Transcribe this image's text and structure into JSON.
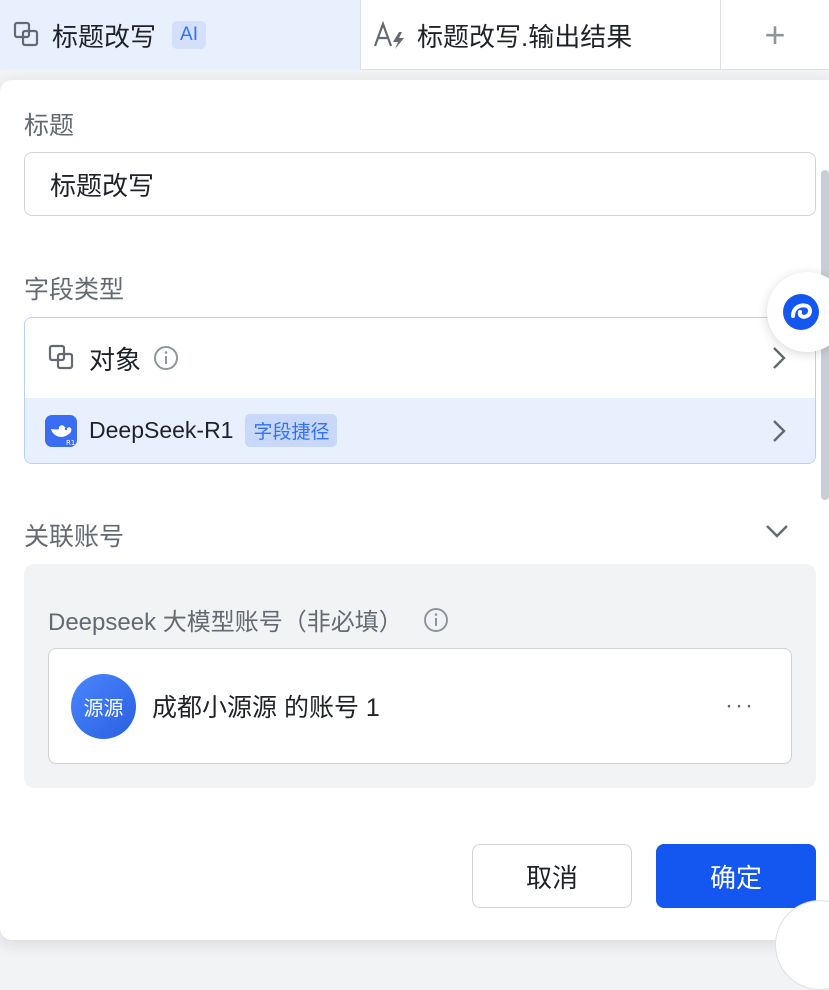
{
  "header": {
    "col1_title": "标题改写",
    "col1_badge": "AI",
    "col2_title": "标题改写.输出结果",
    "add_symbol": "+"
  },
  "form": {
    "title_label": "标题",
    "title_value": "标题改写",
    "field_type_label": "字段类型",
    "field_type_value": "对象",
    "shortcut_name": "DeepSeek-R1",
    "shortcut_tag": "字段捷径",
    "linked_account_label": "关联账号",
    "account_sub_label": "Deepseek 大模型账号（非必填）",
    "account_avatar_text": "源源",
    "account_name": "成都小源源 的账号 1",
    "more_symbol": "···"
  },
  "actions": {
    "cancel_label": "取消",
    "confirm_label": "确定"
  },
  "colors": {
    "primary": "#1456f0",
    "accent": "#3370ff",
    "selected_bg": "#e8effd"
  },
  "icons": [
    "object-field-icon",
    "formula-icon",
    "plus-icon",
    "info-icon",
    "chevron-right-icon",
    "deepseek-logo-icon",
    "chevron-down-icon",
    "assistant-icon",
    "more-icon"
  ]
}
